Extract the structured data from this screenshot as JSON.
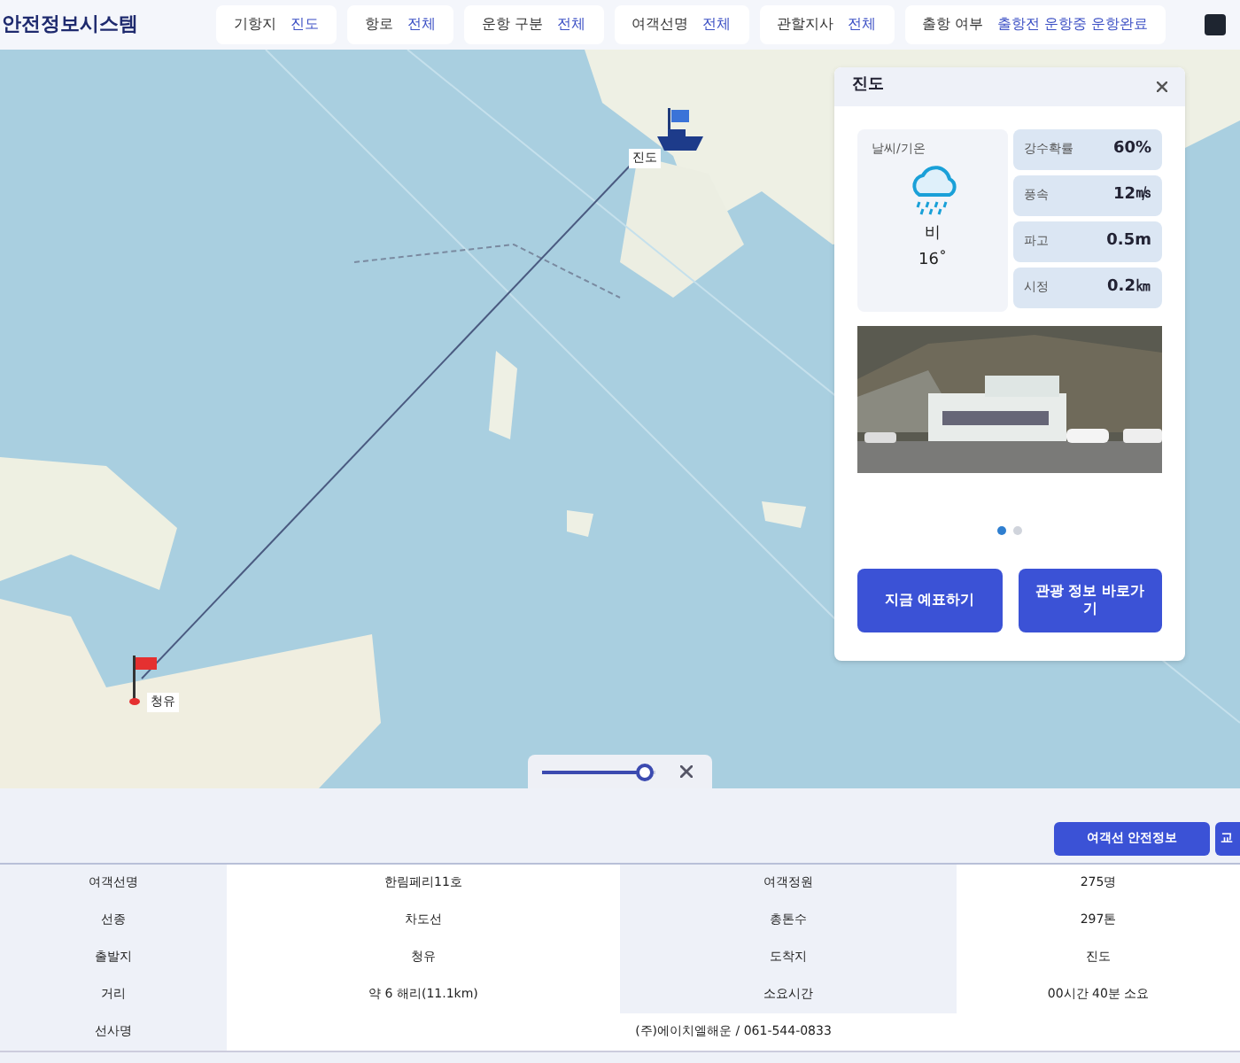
{
  "header": {
    "logo": "안전정보시스템",
    "filters": [
      {
        "label": "기항지",
        "value": "진도"
      },
      {
        "label": "항로",
        "value": "전체"
      },
      {
        "label": "운항 구분",
        "value": "전체"
      },
      {
        "label": "여객선명",
        "value": "전체"
      },
      {
        "label": "관할지사",
        "value": "전체"
      },
      {
        "label": "출항 여부",
        "value": "출항전 운항중 운항완료"
      }
    ]
  },
  "map": {
    "ports": [
      {
        "name": "진도",
        "kind": "destination"
      },
      {
        "name": "청유",
        "kind": "origin"
      }
    ],
    "zoom_slider": {
      "level": 0.9
    }
  },
  "port_card": {
    "title": "진도",
    "weather": {
      "label": "날씨/기온",
      "condition": "비",
      "temperature": "16˚"
    },
    "stats": [
      {
        "label": "강수확률",
        "value": "60%"
      },
      {
        "label": "풍속",
        "value": "12㎧"
      },
      {
        "label": "파고",
        "value": "0.5m"
      },
      {
        "label": "시정",
        "value": "0.2㎞"
      }
    ],
    "pager": [
      {
        "selected": true
      },
      {
        "selected": false
      }
    ],
    "buttons": [
      "지금 예표하기",
      "관광 정보 바로가기"
    ]
  },
  "info_panel": {
    "buttons": [
      "여객선 안전정보",
      "교"
    ],
    "rows": [
      [
        "여객선명",
        "한림페리11호",
        "여객정원",
        "275명"
      ],
      [
        "선종",
        "차도선",
        "총톤수",
        "297톤"
      ],
      [
        "출발지",
        "청유",
        "도착지",
        "진도"
      ],
      [
        "거리",
        "약 6 해리(11.1km)",
        "소요시간",
        "00시간 40분 소요"
      ],
      [
        "선사명",
        {
          "text": "(주)에이치엘해운 / 061-544-0833",
          "colspan": 3
        }
      ]
    ]
  }
}
